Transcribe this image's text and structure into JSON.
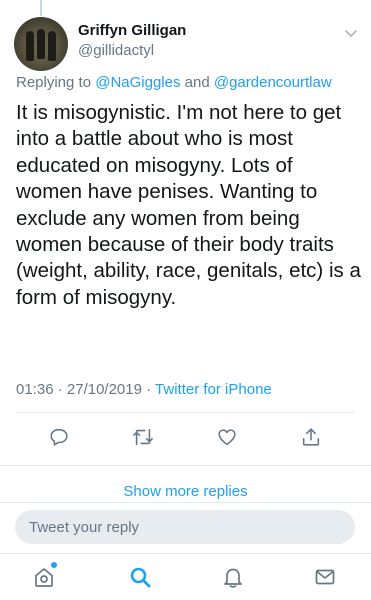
{
  "tweet": {
    "author_name": "Griffyn Gilligan",
    "author_handle": "@gillidactyl",
    "replying_prefix": "Replying to ",
    "mention_1": "@NaGiggles",
    "replying_and": " and ",
    "mention_2": "@gardencourtlaw",
    "text": "It is misogynistic. I'm not here to get\ninto a battle about who is most\neducated on misogyny. Lots of\nwomen have penises. Wanting to\nexclude any women from being\nwomen because of their body traits\n(weight, ability, race, genitals, etc) is a\nform of misogyny.",
    "time": "01:36",
    "date_sep": " · ",
    "date": "27/10/2019",
    "source_sep": " · ",
    "source": "Twitter for iPhone"
  },
  "actions": {
    "reply_icon": "reply-icon",
    "retweet_icon": "retweet-icon",
    "like_icon": "heart-icon",
    "share_icon": "share-icon"
  },
  "show_more_label": "Show more replies",
  "compose": {
    "placeholder": "Tweet your reply"
  },
  "tabbar": {
    "items": [
      "home-icon",
      "search-icon",
      "notifications-icon",
      "messages-icon"
    ],
    "active": "search-icon"
  },
  "colors": {
    "accent": "#1da1f2",
    "secondary_text": "#657786",
    "primary_text": "#14171a",
    "divider": "#e1e8ed",
    "compose_bg": "#e6ecf0"
  }
}
